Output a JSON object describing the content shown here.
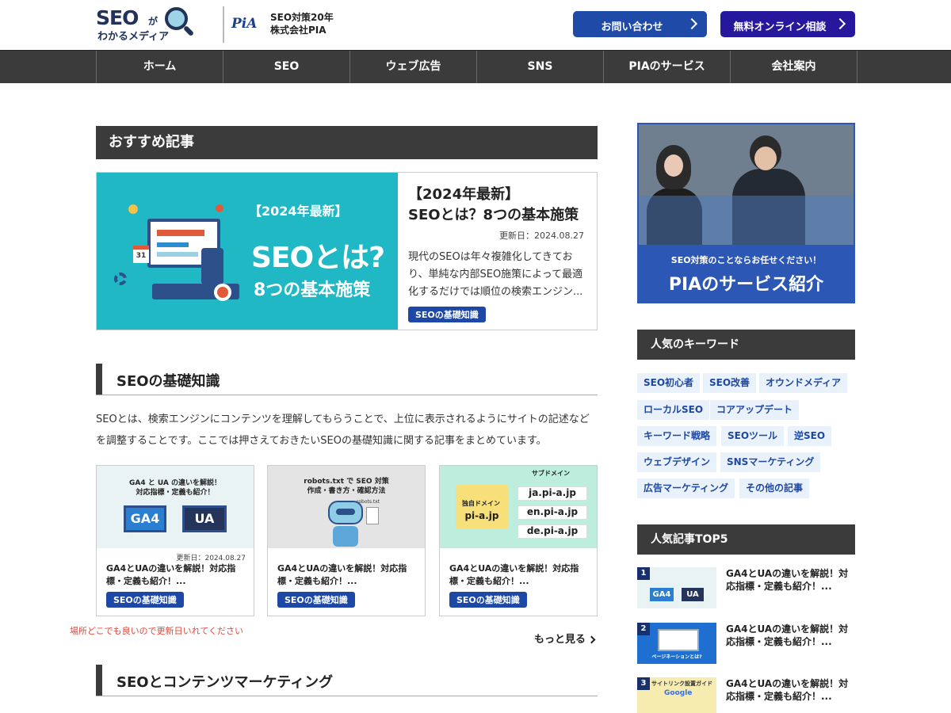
{
  "header": {
    "logo_main": "SEO",
    "logo_ga": "が",
    "logo_sub": "わかるメディア",
    "pia_logo": "PiA",
    "company_line1": "SEO対策20年",
    "company_line2": "株式会社PIA",
    "contact_label": "お問い合わせ",
    "consult_label": "無料オンライン相談"
  },
  "nav": [
    "ホーム",
    "SEO",
    "ウェブ広告",
    "SNS",
    "PIAのサービス",
    "会社案内"
  ],
  "recommended": {
    "heading": "おすすめ記事",
    "image_badge": "【2024年最新】",
    "image_big": "SEOとは?",
    "image_sub": "8つの基本施策",
    "image_cal": "31",
    "title_line1": "【2024年最新】",
    "title_line2": "SEOとは？8つの基本施策",
    "date": "更新日：2024.08.27",
    "description": "現代のSEOは年々複雑化してきており、単純な内部SEO施策によって最適化するだけでは順位の検索エンジン...",
    "tag": "SEOの基礎知識"
  },
  "basics": {
    "heading": "SEOの基礎知識",
    "description": "SEOとは、検索エンジンにコンテンツを理解してもらうことで、上位に表示されるようにサイトの記述などを調整することです。ここでは押さえておきたいSEOの基礎知識に関する記事をまとめています。",
    "cards": [
      {
        "img_line1": "GA4 と UA の違いを解説！",
        "img_line2": "対応指標・定義も紹介！",
        "img_ga4": "GA4",
        "img_ua": "UA",
        "date": "更新日：2024.08.27",
        "title": "GA4とUAの違いを解説！対応指標・定義も紹介！...",
        "tag": "SEOの基礎知識"
      },
      {
        "img_line1": "robots.txt で SEO 対策",
        "img_line2": "作成・書き方・確認方法",
        "img_file": "robots.txt",
        "title": "GA4とUAの違いを解説！対応指標・定義も紹介！...",
        "tag": "SEOの基礎知識"
      },
      {
        "img_sub": "サブドメイン",
        "img_own": "独自ドメイン",
        "img_main": "pi-a.jp",
        "img_ja": "ja.pi-a.jp",
        "img_en": "en.pi-a.jp",
        "img_de": "de.pi-a.jp",
        "title": "GA4とUAの違いを解説！対応指標・定義も紹介！...",
        "tag": "SEOの基礎知識"
      }
    ],
    "more": "もっと見る",
    "note": "場所どこでも良いので更新日いれてください"
  },
  "content_marketing": {
    "heading": "SEOとコンテンツマーケティング"
  },
  "sidebar": {
    "banner_sub": "SEO対策のことならお任せください！",
    "banner_main": "PIAのサービス紹介",
    "keywords_heading": "人気のキーワード",
    "keywords": [
      "SEO初心者",
      "SEO改善",
      "オウンドメディア",
      "ローカルSEO",
      "コアアップデート",
      "キーワード戦略",
      "SEOツール",
      "逆SEO",
      "ウェブデザイン",
      "SNSマーケティング",
      "広告マーケティング",
      "その他の記事"
    ],
    "top5_heading": "人気記事TOP5",
    "top5": [
      {
        "num": "1",
        "title": "GA4とUAの違いを解説！対応指標・定義も紹介！...",
        "img_a": "GA4",
        "img_b": "UA"
      },
      {
        "num": "2",
        "title": "GA4とUAの違いを解説！対応指標・定義も紹介！...",
        "img_text": "ページネーションとは?"
      },
      {
        "num": "3",
        "title": "GA4とUAの違いを解説！対応指標・定義も紹介！...",
        "img_text": "サイトリンク設置ガイド",
        "img_brand": "Google"
      }
    ]
  },
  "colors": {
    "nav_bg": "#3b3b3b",
    "accent_blue": "#1e48a5",
    "consult_purple": "#26189c",
    "teal": "#1fb8c4",
    "note_red": "#e0483a"
  }
}
